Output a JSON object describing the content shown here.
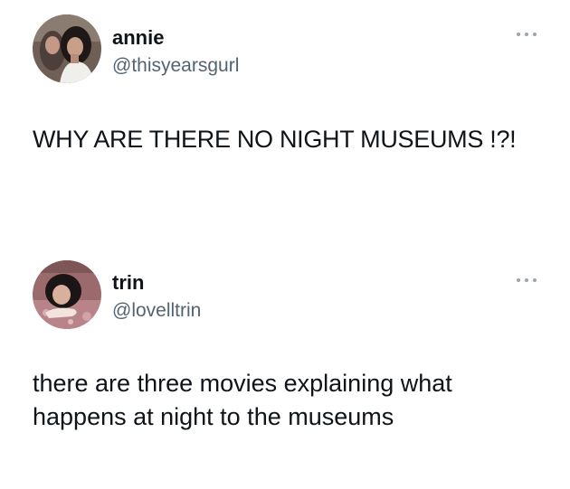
{
  "tweets": [
    {
      "display_name": "annie",
      "handle": "@thisyearsgurl",
      "text": "WHY ARE THERE NO NIGHT MUSEUMS !?!",
      "avatar_icon": "profile-photo-icon",
      "more_icon": "more-options-icon"
    },
    {
      "display_name": "trin",
      "handle": "@lovelltrin",
      "text": "there are three movies explaining what happens at night to the museums",
      "avatar_icon": "profile-photo-icon",
      "more_icon": "more-options-icon"
    }
  ],
  "colors": {
    "text_primary": "#0f1419",
    "text_secondary": "#536471",
    "icon_gray": "#9aa5af",
    "background": "#ffffff"
  }
}
